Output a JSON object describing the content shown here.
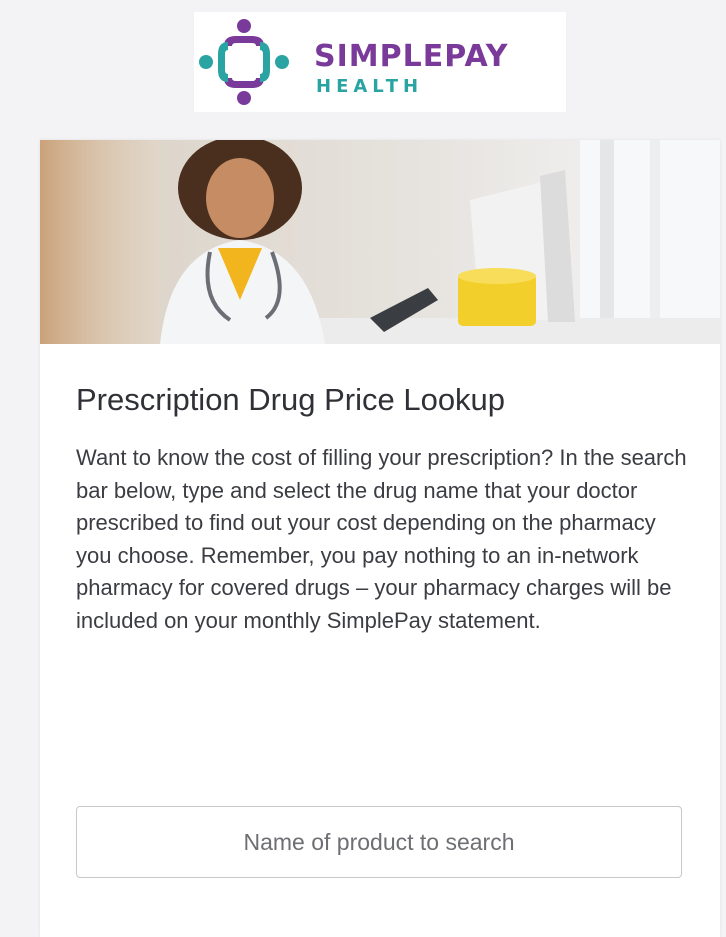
{
  "brand": {
    "name_line1": "SIMPLEPAY",
    "name_line2": "HEALTH",
    "logo_icon": "four-people-circle-logo-icon",
    "primary_color": "#7a3a9a",
    "secondary_color": "#2aa4a2"
  },
  "hero": {
    "image": "doctor-smiling-photo"
  },
  "card": {
    "title": "Prescription Drug Price Lookup",
    "description": "Want to know the cost of filling your prescription? In the search bar below, type and select the drug name that your doctor prescribed to find out your cost depending on the pharmacy you choose. Remember, you pay nothing to an in-network pharmacy for covered drugs – your pharmacy charges will be included on your monthly SimplePay statement."
  },
  "search": {
    "placeholder": "Name of product to search",
    "value": ""
  }
}
